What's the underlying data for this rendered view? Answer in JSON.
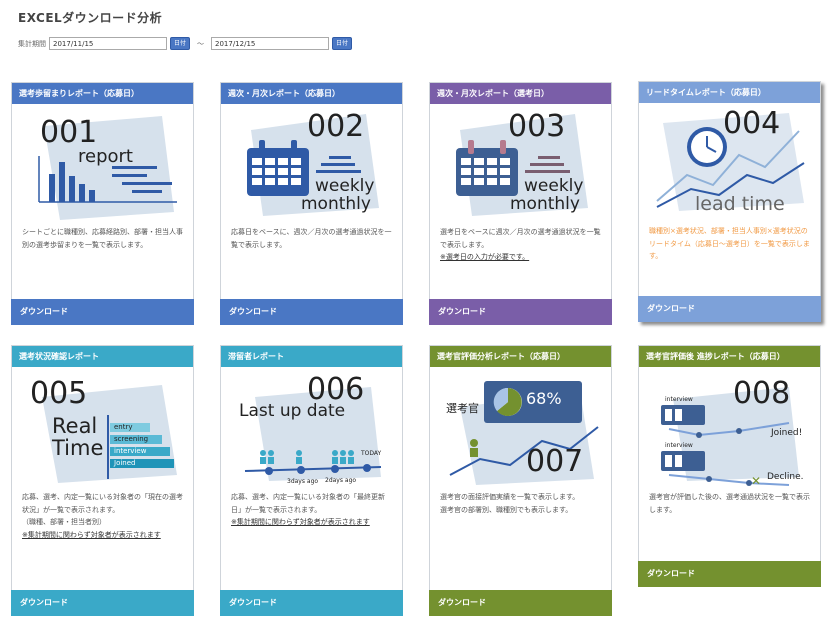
{
  "page": {
    "title": "EXCELダウンロード分析",
    "period_label": "集計期間",
    "date_from": "2017/11/15",
    "date_to": "2017/12/15",
    "date_separator": "～",
    "calendar_button": "日付"
  },
  "colors": {
    "blue": "#4a77c4",
    "purple": "#7a5ea8",
    "light_blue": "#7da1d9",
    "teal": "#3aa9c8",
    "green": "#74912f",
    "orange_text": "#f19a45"
  },
  "cards": [
    {
      "header": "選考歩留まりレポート（応募日）",
      "number": "001",
      "img_text": "report",
      "desc": [
        "シートごとに職種別、応募経路別、部署・担当人事別の選考歩留まりを一覧で表示します。"
      ],
      "footer": "ダウンロード"
    },
    {
      "header": "週次・月次レポート（応募日）",
      "number": "002",
      "img_text_1": "weekly",
      "img_text_2": "monthly",
      "desc": [
        "応募日をベースに、週次／月次の選考通過状況を一覧で表示します。"
      ],
      "footer": "ダウンロード"
    },
    {
      "header": "週次・月次レポート（選考日）",
      "number": "003",
      "img_text_1": "weekly",
      "img_text_2": "monthly",
      "desc": [
        "選考日をベースに週次／月次の選考通過状況を一覧で表示します。"
      ],
      "link": "※選考日の入力が必要です。",
      "footer": "ダウンロード"
    },
    {
      "header": "リードタイムレポート（応募日）",
      "number": "004",
      "img_text": "lead time",
      "desc": [
        "職種別×選考状況、部署・担当人事別×選考状況のリードタイム（応募日〜選考日）を一覧で表示します。"
      ],
      "footer": "ダウンロード"
    },
    {
      "header": "選考状況確認レポート",
      "number": "005",
      "img_text_1": "Real",
      "img_text_2": "Time",
      "bars": [
        "entry",
        "screening",
        "interview",
        "Joined"
      ],
      "desc": [
        "応募、選考、内定一覧にいる対象者の「現在の選考状況」が一覧で表示されます。",
        "（職種、部署・担当者別）"
      ],
      "link": "※集計期間に関わらず対象者が表示されます",
      "footer": "ダウンロード"
    },
    {
      "header": "滞留者レポート",
      "number": "006",
      "img_text": "Last up date",
      "timeline_labels": [
        "3days ago",
        "2days ago",
        "TODAY"
      ],
      "desc": [
        "応募、選考、内定一覧にいる対象者の「最終更新日」が一覧で表示されます。"
      ],
      "link": "※集計期間に関わらず対象者が表示されます",
      "footer": "ダウンロード"
    },
    {
      "header": "選考官評価分析レポート（応募日）",
      "number": "007",
      "percent": "68%",
      "img_label": "選考官",
      "desc": [
        "選考官の面接評価実績を一覧で表示します。",
        "選考官の部署別、職種別でも表示します。"
      ],
      "footer": "ダウンロード"
    },
    {
      "header": "選考官評価後 進捗レポート（応募日）",
      "number": "008",
      "stages": [
        "interview",
        "interview"
      ],
      "img_text_joined": "Joined!",
      "img_text_decline": "Decline.",
      "desc": [
        "選考官が評価した後の、選考通過状況を一覧で表示します。"
      ],
      "footer": "ダウンロード"
    }
  ]
}
